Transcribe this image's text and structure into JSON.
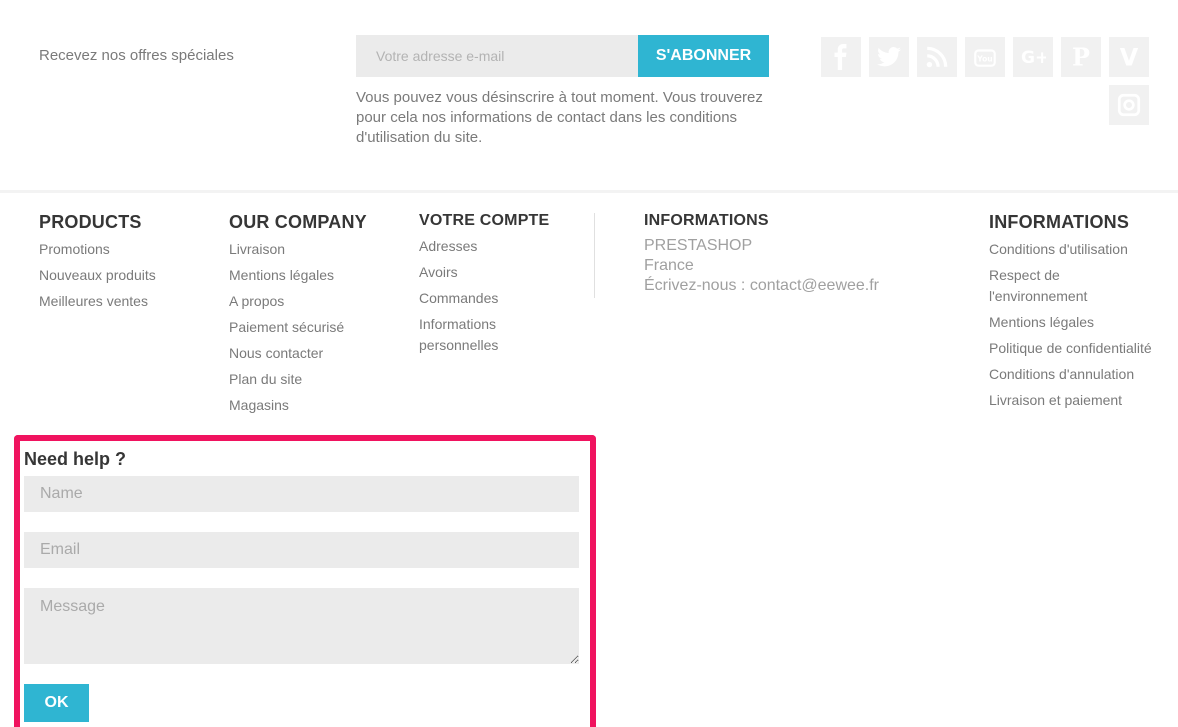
{
  "newsletter": {
    "label": "Recevez nos offres spéciales",
    "email_placeholder": "Votre adresse e-mail",
    "subscribe_label": "S'ABONNER",
    "note": "Vous pouvez vous désinscrire à tout moment. Vous trouverez pour cela nos informations de contact dans les conditions d'utilisation du site."
  },
  "social": [
    {
      "name": "facebook-icon",
      "glyph": "f"
    },
    {
      "name": "twitter-icon",
      "glyph": "t"
    },
    {
      "name": "rss-icon",
      "glyph": "rss"
    },
    {
      "name": "youtube-icon",
      "glyph": "yt"
    },
    {
      "name": "googleplus-icon",
      "glyph": "G+"
    },
    {
      "name": "pinterest-icon",
      "glyph": "P"
    },
    {
      "name": "vimeo-icon",
      "glyph": "V"
    },
    {
      "name": "instagram-icon",
      "glyph": "ig"
    }
  ],
  "footer": {
    "products": {
      "title": "PRODUCTS",
      "items": [
        "Promotions",
        "Nouveaux produits",
        "Meilleures ventes"
      ]
    },
    "company": {
      "title": "OUR COMPANY",
      "items": [
        "Livraison",
        "Mentions légales",
        "A propos",
        "Paiement sécurisé",
        "Nous contacter",
        "Plan du site",
        "Magasins"
      ]
    },
    "account": {
      "title": "VOTRE COMPTE",
      "items": [
        "Adresses",
        "Avoirs",
        "Commandes",
        "Informations personnelles"
      ]
    },
    "info_store": {
      "title": "INFORMATIONS",
      "line1": "PRESTASHOP",
      "line2": "France",
      "line3": "Écrivez-nous : contact@eewee.fr"
    },
    "info_links": {
      "title": "INFORMATIONS",
      "items": [
        "Conditions d'utilisation",
        "Respect de l'environnement",
        "Mentions légales",
        "Politique de confidentialité",
        "Conditions d'annulation",
        "Livraison et paiement"
      ]
    }
  },
  "help": {
    "title": "Need help ?",
    "name_placeholder": "Name",
    "email_placeholder": "Email",
    "message_placeholder": "Message",
    "ok_label": "OK"
  },
  "colors": {
    "accent": "#2fb5d2",
    "highlight_border": "#f0135f"
  }
}
